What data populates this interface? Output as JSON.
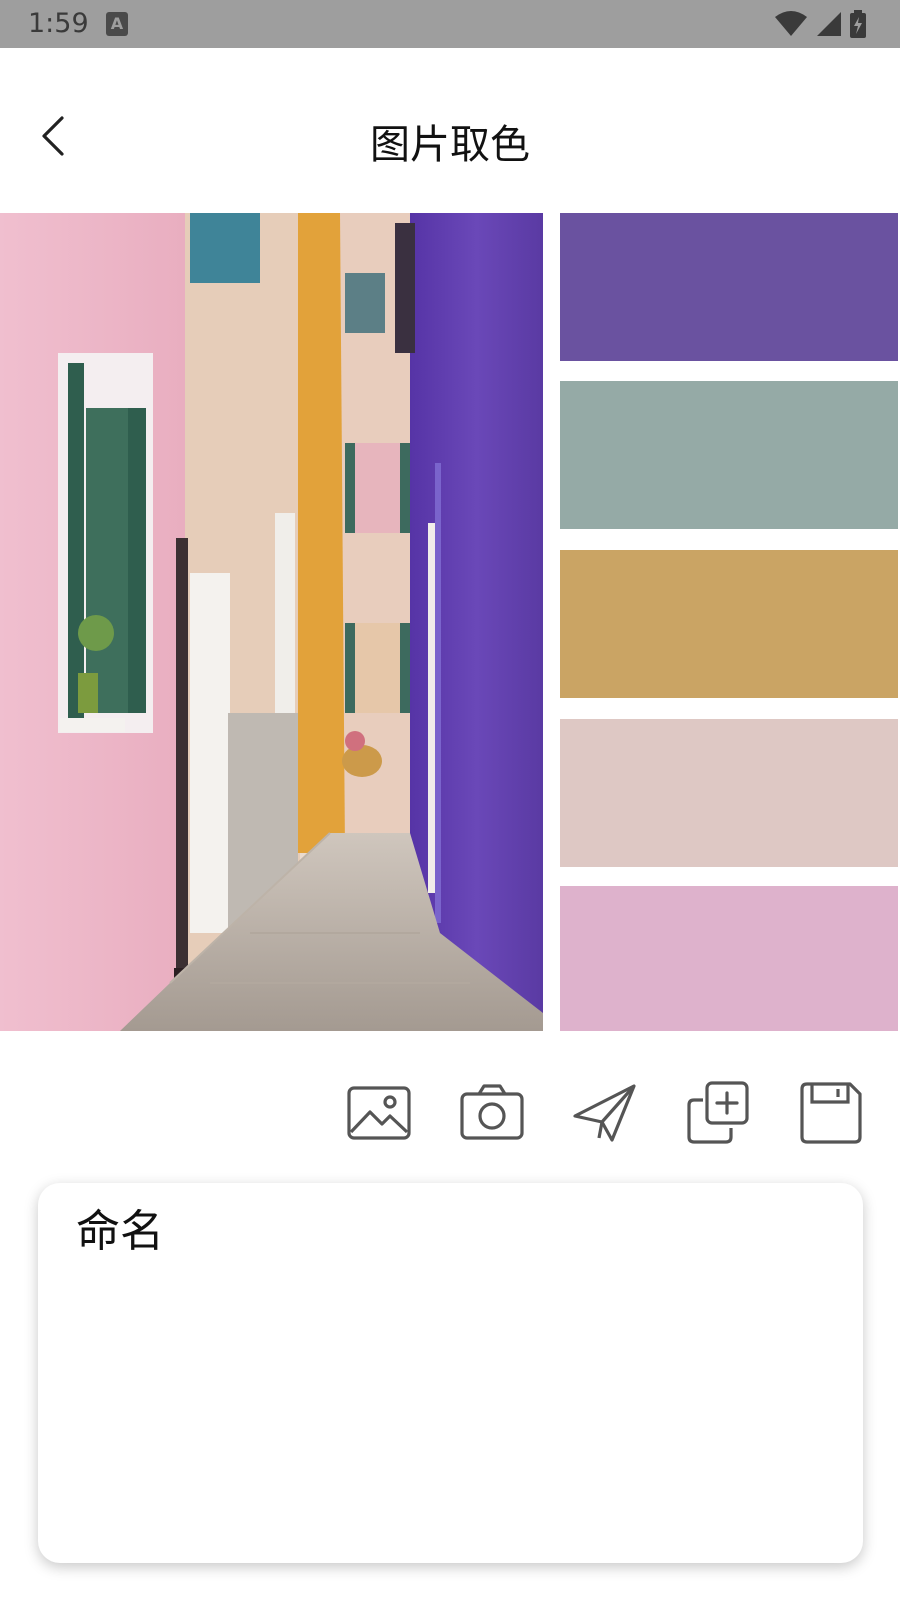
{
  "status_bar": {
    "time": "1:59",
    "notification_glyph": "A"
  },
  "header": {
    "title": "图片取色"
  },
  "palette": {
    "swatches": [
      {
        "color": "#6a52a0"
      },
      {
        "color": "#95aaa6"
      },
      {
        "color": "#caa464"
      },
      {
        "color": "#dec8c4"
      },
      {
        "color": "#deb2cc"
      }
    ]
  },
  "toolbar": {
    "icons": [
      "image-icon",
      "camera-icon",
      "send-icon",
      "duplicate-add-icon",
      "save-icon"
    ]
  },
  "name_card": {
    "value": "命名"
  },
  "colors": {
    "status_bar": "#9e9e9e",
    "icon_stroke": "#555555"
  }
}
